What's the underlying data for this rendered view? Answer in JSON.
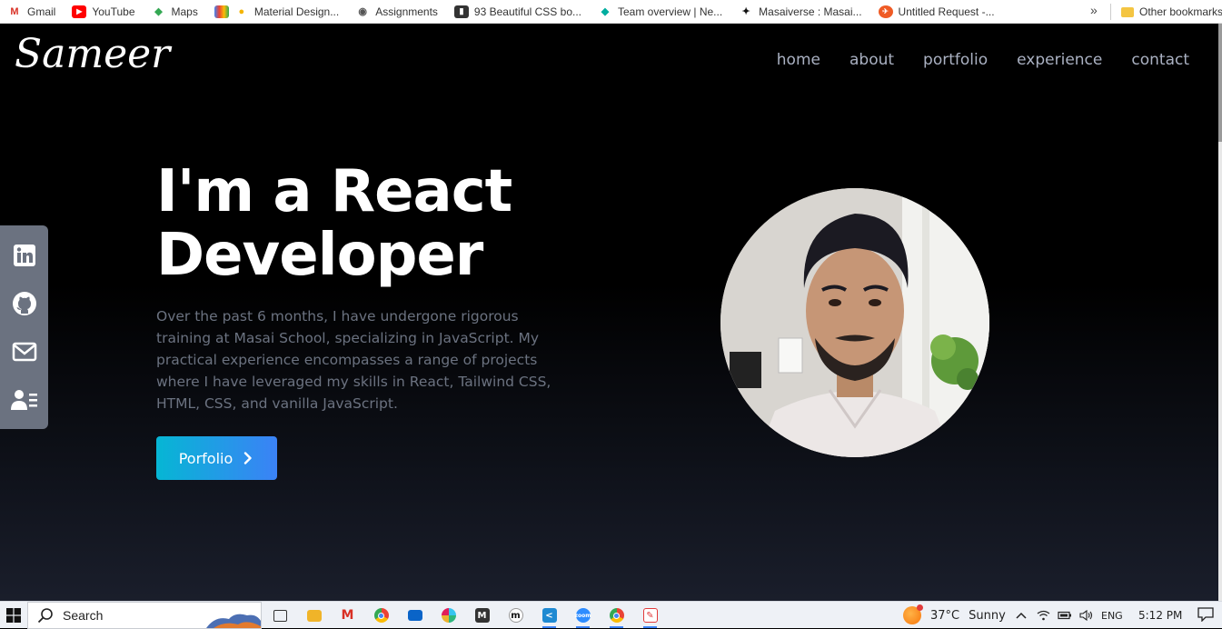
{
  "bookmarks": {
    "items": [
      {
        "label": "Gmail",
        "icon": "gmail-icon",
        "color": "#d93025"
      },
      {
        "label": "YouTube",
        "icon": "youtube-icon",
        "color": "#ff0000"
      },
      {
        "label": "Maps",
        "icon": "maps-icon",
        "color": "#34a853"
      },
      {
        "label": "Material Design...",
        "icon": "material-design-icon",
        "color": "#f4b400"
      },
      {
        "label": "Assignments",
        "icon": "assignments-icon",
        "color": "#555555"
      },
      {
        "label": "93 Beautiful CSS bo...",
        "icon": "css-icon",
        "color": "#333333"
      },
      {
        "label": "Team overview | Ne...",
        "icon": "netlify-icon",
        "color": "#00ad9f"
      },
      {
        "label": "Masaiverse : Masai...",
        "icon": "masai-icon",
        "color": "#111111"
      },
      {
        "label": "Untitled Request -...",
        "icon": "postman-icon",
        "color": "#ef5b25"
      }
    ],
    "more": "»",
    "other": "Other bookmarks"
  },
  "site": {
    "logo": "Sameer",
    "nav": [
      "home",
      "about",
      "portfolio",
      "experience",
      "contact"
    ],
    "hero": {
      "line1": "I'm a React",
      "line2": "Developer",
      "description": "Over the past 6 months, I have undergone rigorous training at Masai School, specializing in JavaScript. My practical experience encompasses a range of projects where I have leveraged my skills in React, Tailwind CSS, HTML, CSS, and vanilla JavaScript.",
      "cta": "Porfolio"
    },
    "social": [
      "linkedin-icon",
      "github-icon",
      "mail-icon",
      "resume-icon"
    ],
    "colors": {
      "accent_from": "#06b6d4",
      "accent_to": "#3b82f6",
      "nav_text": "#aab1c2",
      "desc_text": "#6b7280"
    }
  },
  "taskbar": {
    "search_placeholder": "Search",
    "weather_temp": "37°C",
    "weather_desc": "Sunny",
    "language": "ENG",
    "time": "5:12 PM"
  }
}
